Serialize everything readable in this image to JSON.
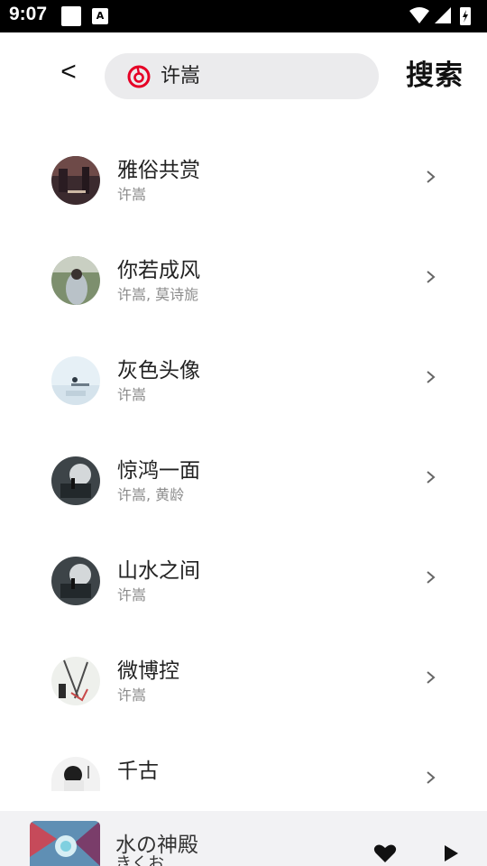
{
  "statusbar": {
    "time": "9:07",
    "notif_badge": "A"
  },
  "header": {
    "back_label": "<",
    "search_query": "许嵩",
    "search_button": "搜索",
    "logo_color": "#e60026"
  },
  "results": [
    {
      "title": "雅俗共赏",
      "artist": "许嵩"
    },
    {
      "title": "你若成风",
      "artist": "许嵩, 莫诗旎"
    },
    {
      "title": "灰色头像",
      "artist": "许嵩"
    },
    {
      "title": "惊鸿一面",
      "artist": "许嵩, 黄龄"
    },
    {
      "title": "山水之间",
      "artist": "许嵩"
    },
    {
      "title": "微博控",
      "artist": "许嵩"
    },
    {
      "title": "千古",
      "artist": ""
    }
  ],
  "player": {
    "song": "水の神殿",
    "sub": "きくお"
  },
  "colors": {
    "accent": "#e60026",
    "subtext": "#8c8c8c",
    "player_bg": "#f2f2f4"
  },
  "icons": {
    "back": "back-arrow-icon",
    "logo": "netease-music-logo-icon",
    "chevron": "chevron-right-icon",
    "heart": "heart-icon",
    "play": "play-icon"
  }
}
